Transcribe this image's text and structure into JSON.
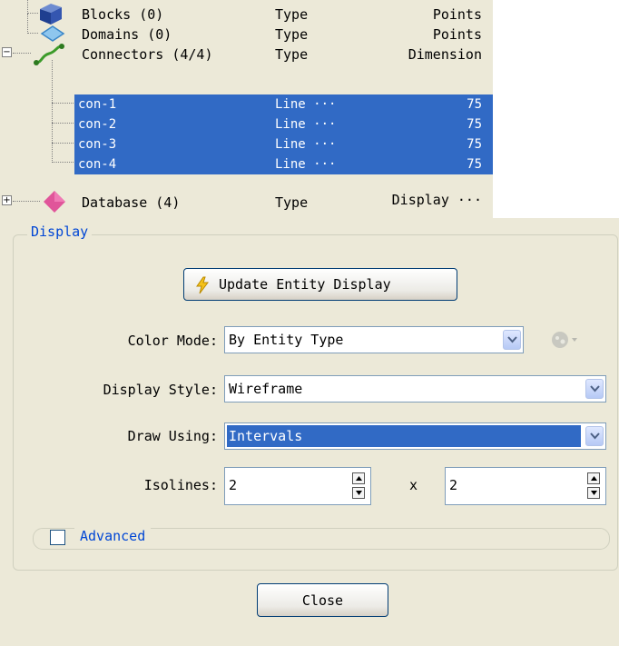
{
  "tree": {
    "rows": [
      {
        "name": "Blocks (0)",
        "type": "Type",
        "extra": "Points"
      },
      {
        "name": "Domains (0)",
        "type": "Type",
        "extra": "Points"
      },
      {
        "name": "Connectors (4/4)",
        "type": "Type",
        "extra": "Dimension"
      },
      {
        "name": "Database (4)",
        "type": "Type",
        "extra": "Display ···"
      }
    ],
    "connectors": [
      {
        "name": "con-1",
        "type": "Line ···",
        "dimension": "75"
      },
      {
        "name": "con-2",
        "type": "Line ···",
        "dimension": "75"
      },
      {
        "name": "con-3",
        "type": "Line ···",
        "dimension": "75"
      },
      {
        "name": "con-4",
        "type": "Line ···",
        "dimension": "75"
      }
    ],
    "expand_minus": "−",
    "expand_plus": "+"
  },
  "panel": {
    "group_title": "Display",
    "update_button": "Update Entity Display",
    "color_mode": {
      "label": "Color Mode:",
      "value": "By Entity Type"
    },
    "display_style": {
      "label": "Display Style:",
      "value": "Wireframe"
    },
    "draw_using": {
      "label": "Draw Using:",
      "value": "Intervals"
    },
    "isolines": {
      "label": "Isolines:",
      "value_u": "2",
      "separator": "x",
      "value_v": "2"
    },
    "advanced": {
      "label": "Advanced",
      "checked": false
    },
    "close_button": "Close"
  },
  "colors": {
    "selection": "#316ac5",
    "dialog_bg": "#ece9d8",
    "group_title": "#0046d5"
  },
  "icons": [
    "block-icon",
    "domain-icon",
    "connector-icon",
    "database-icon",
    "lightning-icon",
    "color-wheel-icon",
    "chevron-down-icon",
    "spin-up-icon",
    "spin-down-icon"
  ]
}
